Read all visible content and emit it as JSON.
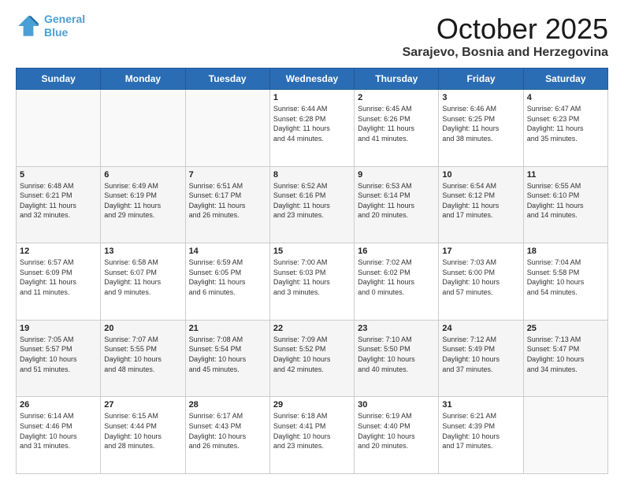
{
  "header": {
    "logo_line1": "General",
    "logo_line2": "Blue",
    "month": "October 2025",
    "location": "Sarajevo, Bosnia and Herzegovina"
  },
  "weekdays": [
    "Sunday",
    "Monday",
    "Tuesday",
    "Wednesday",
    "Thursday",
    "Friday",
    "Saturday"
  ],
  "weeks": [
    [
      {
        "day": "",
        "info": ""
      },
      {
        "day": "",
        "info": ""
      },
      {
        "day": "",
        "info": ""
      },
      {
        "day": "1",
        "info": "Sunrise: 6:44 AM\nSunset: 6:28 PM\nDaylight: 11 hours\nand 44 minutes."
      },
      {
        "day": "2",
        "info": "Sunrise: 6:45 AM\nSunset: 6:26 PM\nDaylight: 11 hours\nand 41 minutes."
      },
      {
        "day": "3",
        "info": "Sunrise: 6:46 AM\nSunset: 6:25 PM\nDaylight: 11 hours\nand 38 minutes."
      },
      {
        "day": "4",
        "info": "Sunrise: 6:47 AM\nSunset: 6:23 PM\nDaylight: 11 hours\nand 35 minutes."
      }
    ],
    [
      {
        "day": "5",
        "info": "Sunrise: 6:48 AM\nSunset: 6:21 PM\nDaylight: 11 hours\nand 32 minutes."
      },
      {
        "day": "6",
        "info": "Sunrise: 6:49 AM\nSunset: 6:19 PM\nDaylight: 11 hours\nand 29 minutes."
      },
      {
        "day": "7",
        "info": "Sunrise: 6:51 AM\nSunset: 6:17 PM\nDaylight: 11 hours\nand 26 minutes."
      },
      {
        "day": "8",
        "info": "Sunrise: 6:52 AM\nSunset: 6:16 PM\nDaylight: 11 hours\nand 23 minutes."
      },
      {
        "day": "9",
        "info": "Sunrise: 6:53 AM\nSunset: 6:14 PM\nDaylight: 11 hours\nand 20 minutes."
      },
      {
        "day": "10",
        "info": "Sunrise: 6:54 AM\nSunset: 6:12 PM\nDaylight: 11 hours\nand 17 minutes."
      },
      {
        "day": "11",
        "info": "Sunrise: 6:55 AM\nSunset: 6:10 PM\nDaylight: 11 hours\nand 14 minutes."
      }
    ],
    [
      {
        "day": "12",
        "info": "Sunrise: 6:57 AM\nSunset: 6:09 PM\nDaylight: 11 hours\nand 11 minutes."
      },
      {
        "day": "13",
        "info": "Sunrise: 6:58 AM\nSunset: 6:07 PM\nDaylight: 11 hours\nand 9 minutes."
      },
      {
        "day": "14",
        "info": "Sunrise: 6:59 AM\nSunset: 6:05 PM\nDaylight: 11 hours\nand 6 minutes."
      },
      {
        "day": "15",
        "info": "Sunrise: 7:00 AM\nSunset: 6:03 PM\nDaylight: 11 hours\nand 3 minutes."
      },
      {
        "day": "16",
        "info": "Sunrise: 7:02 AM\nSunset: 6:02 PM\nDaylight: 11 hours\nand 0 minutes."
      },
      {
        "day": "17",
        "info": "Sunrise: 7:03 AM\nSunset: 6:00 PM\nDaylight: 10 hours\nand 57 minutes."
      },
      {
        "day": "18",
        "info": "Sunrise: 7:04 AM\nSunset: 5:58 PM\nDaylight: 10 hours\nand 54 minutes."
      }
    ],
    [
      {
        "day": "19",
        "info": "Sunrise: 7:05 AM\nSunset: 5:57 PM\nDaylight: 10 hours\nand 51 minutes."
      },
      {
        "day": "20",
        "info": "Sunrise: 7:07 AM\nSunset: 5:55 PM\nDaylight: 10 hours\nand 48 minutes."
      },
      {
        "day": "21",
        "info": "Sunrise: 7:08 AM\nSunset: 5:54 PM\nDaylight: 10 hours\nand 45 minutes."
      },
      {
        "day": "22",
        "info": "Sunrise: 7:09 AM\nSunset: 5:52 PM\nDaylight: 10 hours\nand 42 minutes."
      },
      {
        "day": "23",
        "info": "Sunrise: 7:10 AM\nSunset: 5:50 PM\nDaylight: 10 hours\nand 40 minutes."
      },
      {
        "day": "24",
        "info": "Sunrise: 7:12 AM\nSunset: 5:49 PM\nDaylight: 10 hours\nand 37 minutes."
      },
      {
        "day": "25",
        "info": "Sunrise: 7:13 AM\nSunset: 5:47 PM\nDaylight: 10 hours\nand 34 minutes."
      }
    ],
    [
      {
        "day": "26",
        "info": "Sunrise: 6:14 AM\nSunset: 4:46 PM\nDaylight: 10 hours\nand 31 minutes."
      },
      {
        "day": "27",
        "info": "Sunrise: 6:15 AM\nSunset: 4:44 PM\nDaylight: 10 hours\nand 28 minutes."
      },
      {
        "day": "28",
        "info": "Sunrise: 6:17 AM\nSunset: 4:43 PM\nDaylight: 10 hours\nand 26 minutes."
      },
      {
        "day": "29",
        "info": "Sunrise: 6:18 AM\nSunset: 4:41 PM\nDaylight: 10 hours\nand 23 minutes."
      },
      {
        "day": "30",
        "info": "Sunrise: 6:19 AM\nSunset: 4:40 PM\nDaylight: 10 hours\nand 20 minutes."
      },
      {
        "day": "31",
        "info": "Sunrise: 6:21 AM\nSunset: 4:39 PM\nDaylight: 10 hours\nand 17 minutes."
      },
      {
        "day": "",
        "info": ""
      }
    ]
  ]
}
